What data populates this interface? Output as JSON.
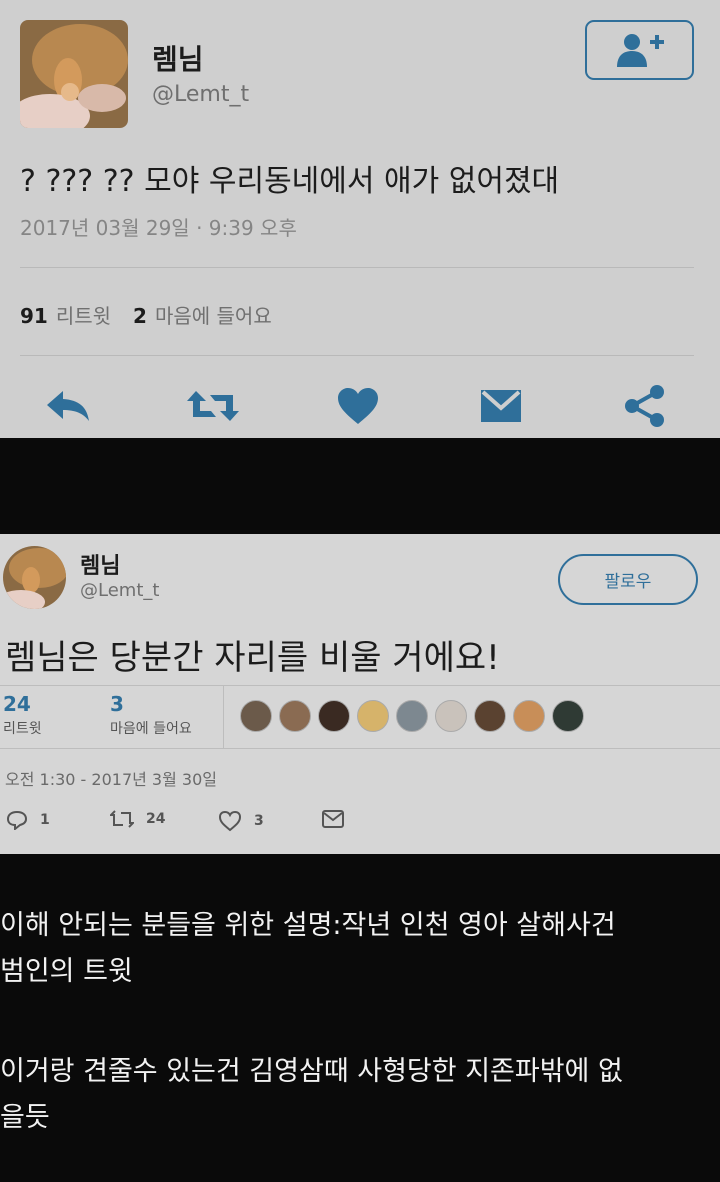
{
  "tweet1": {
    "name": "렘님",
    "handle": "@Lemt_t",
    "text": "? ??? ?? 모야 우리동네에서 애가 없어졌대",
    "timestamp": "2017년 03월 29일 · 9:39 오후",
    "retweet_count": "91",
    "retweet_label": "리트윗",
    "like_count": "2",
    "like_label": "마음에 들어요",
    "icons": [
      "reply-icon",
      "retweet-icon",
      "heart-icon",
      "dm-icon",
      "share-icon"
    ],
    "accent": "#2f6f9a"
  },
  "tweet2": {
    "name": "렘님",
    "handle": "@Lemt_t",
    "follow_label": "팔로우",
    "text": "렘님은 당분간 자리를 비울 거에요!",
    "retweet_count": "24",
    "retweet_label": "리트윗",
    "like_count": "3",
    "like_label": "마음에 들어요",
    "timestamp": "오전 1:30 - 2017년 3월 30일",
    "reply_count": "1",
    "retweet_action_count": "24",
    "like_action_count": "3"
  },
  "caption": {
    "line1": "이해 안되는 분들을 위한 설명:작년 인천 영아 살해사건",
    "line2": "범인의 트윗",
    "line3": "이거랑 견줄수 있는건 김영삼때 사형당한 지존파밖에 없",
    "line4": "을듯"
  }
}
